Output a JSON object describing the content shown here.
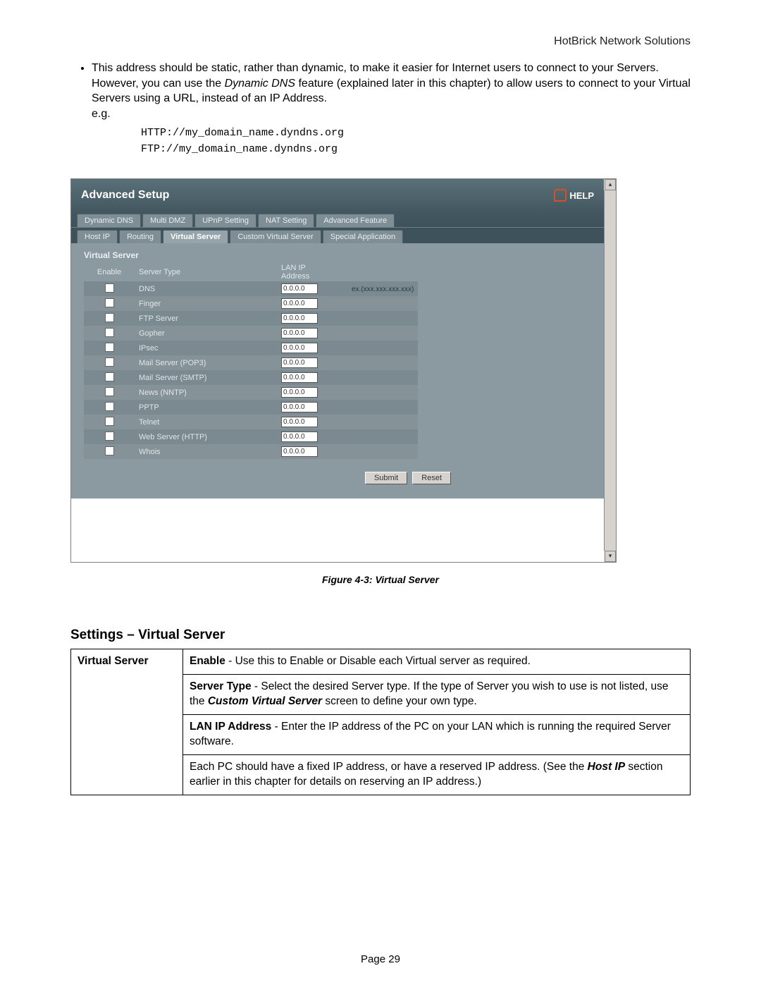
{
  "doc_header": "HotBrick Network Solutions",
  "bullet": {
    "pre": "This address should be static, rather than dynamic, to make it easier for Internet users to connect to your Servers. However, you can use the ",
    "italic": "Dynamic DNS",
    "post": " feature (explained later in this chapter) to allow users to connect to your Virtual Servers using a URL, instead of an IP Address.",
    "eg": "e.g."
  },
  "code1": "HTTP://my_domain_name.dyndns.org",
  "code2": "FTP://my_domain_name.dyndns.org",
  "app": {
    "title": "Advanced Setup",
    "help": "HELP",
    "tabs1": [
      "Dynamic DNS",
      "Multi DMZ",
      "UPnP Setting",
      "NAT Setting",
      "Advanced Feature"
    ],
    "tabs2": [
      "Host IP",
      "Routing",
      "Virtual Server",
      "Custom Virtual Server",
      "Special Application"
    ],
    "active_tab2_index": 2,
    "panel_title": "Virtual Server",
    "col_enable": "Enable",
    "col_type": "Server Type",
    "col_lan": "LAN IP Address",
    "ex_label": "ex.(xxx.xxx.xxx.xxx)",
    "rows": [
      {
        "type": "DNS",
        "ip": "0.0.0.0"
      },
      {
        "type": "Finger",
        "ip": "0.0.0.0"
      },
      {
        "type": "FTP Server",
        "ip": "0.0.0.0"
      },
      {
        "type": "Gopher",
        "ip": "0.0.0.0"
      },
      {
        "type": "IPsec",
        "ip": "0.0.0.0"
      },
      {
        "type": "Mail Server (POP3)",
        "ip": "0.0.0.0"
      },
      {
        "type": "Mail Server (SMTP)",
        "ip": "0.0.0.0"
      },
      {
        "type": "News (NNTP)",
        "ip": "0.0.0.0"
      },
      {
        "type": "PPTP",
        "ip": "0.0.0.0"
      },
      {
        "type": "Telnet",
        "ip": "0.0.0.0"
      },
      {
        "type": "Web Server (HTTP)",
        "ip": "0.0.0.0"
      },
      {
        "type": "Whois",
        "ip": "0.0.0.0"
      }
    ],
    "submit": "Submit",
    "reset": "Reset"
  },
  "fig_caption": "Figure 4-3: Virtual Server",
  "settings_heading": "Settings – Virtual Server",
  "settings": {
    "key": "Virtual Server",
    "enable_b": "Enable",
    "enable_t": " - Use this to Enable or Disable each Virtual server as required.",
    "st_b": "Server Type",
    "st_t1": " - Select the desired Server type. If the type of Server you wish to use is not listed, use the ",
    "st_ib": "Custom Virtual Server",
    "st_t2": " screen to define your own type.",
    "lan_b": "LAN IP Address",
    "lan_t": " - Enter the IP address of the PC on your LAN  which is running the required Server software.",
    "fixed_t1": "Each PC should have a fixed IP address, or have a reserved IP address. (See the ",
    "fixed_ib": "Host IP",
    "fixed_t2": " section earlier in this chapter for details on reserving an IP address.)"
  },
  "page_number": "Page 29"
}
